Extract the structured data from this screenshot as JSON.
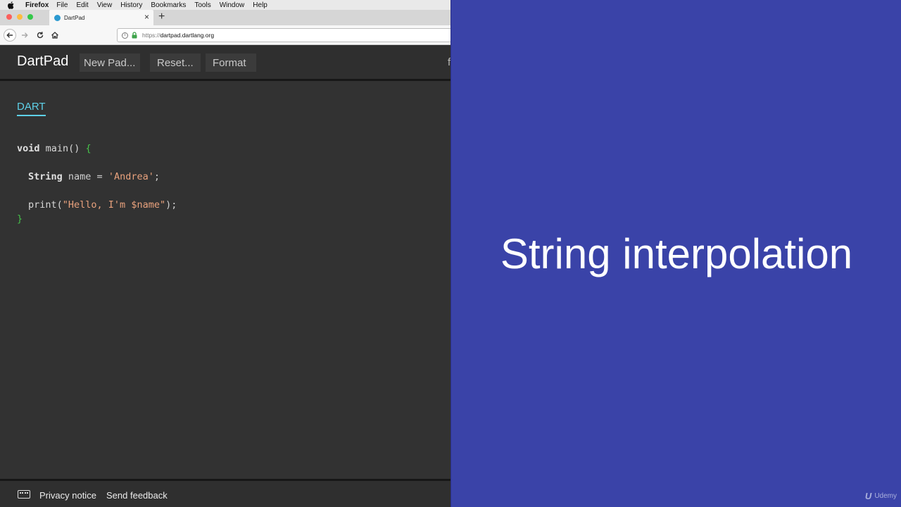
{
  "mac_menu": {
    "app": "Firefox",
    "items": [
      "File",
      "Edit",
      "View",
      "History",
      "Bookmarks",
      "Tools",
      "Window",
      "Help"
    ]
  },
  "browser": {
    "tab_title": "DartPad",
    "tab_close": "×",
    "new_tab": "+",
    "url_scheme": "https://",
    "url_host": "dartpad.dartlang.org"
  },
  "app": {
    "brand": "DartPad",
    "buttons": {
      "new_pad": "New Pad...",
      "reset": "Reset...",
      "format": "Format"
    },
    "overflow_glyph": "f"
  },
  "editor": {
    "language_tab": "DART",
    "code": {
      "l1_kw": "void",
      "l1_fn": " main() ",
      "l1_brace": "{",
      "l2_type": "String",
      "l2_rest": " name = ",
      "l2_str": "'Andrea'",
      "l2_end": ";",
      "l3_fn": "print(",
      "l3_str": "\"Hello, I'm $name\"",
      "l3_end": ");",
      "l4_brace": "}"
    }
  },
  "footer": {
    "privacy": "Privacy notice",
    "feedback": "Send feedback"
  },
  "slide": {
    "title": "String interpolation",
    "watermark": "Udemy",
    "watermark_mark": "U",
    "background": "#3a43a8"
  }
}
